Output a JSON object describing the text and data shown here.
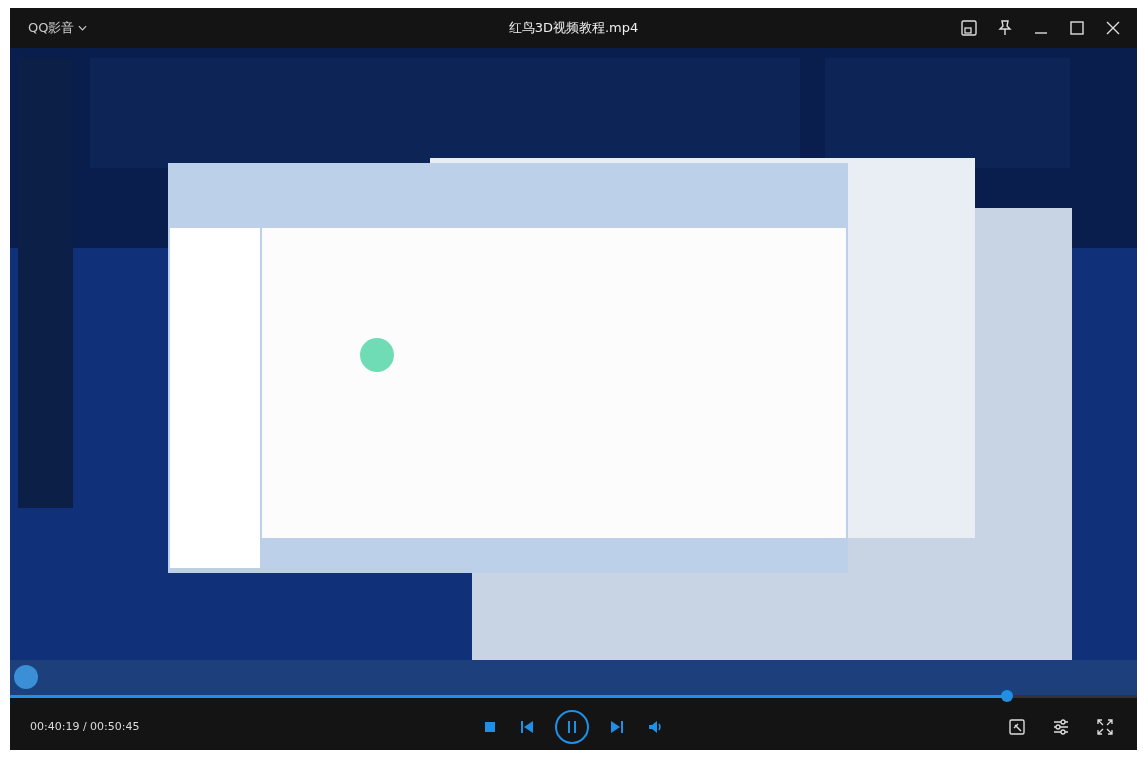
{
  "window": {
    "app_name": "QQ影音",
    "title": "红鸟3D视频教程.mp4"
  },
  "playback": {
    "playing": true,
    "level": 0.885,
    "time": "00:40:19 / 00:50:45"
  }
}
